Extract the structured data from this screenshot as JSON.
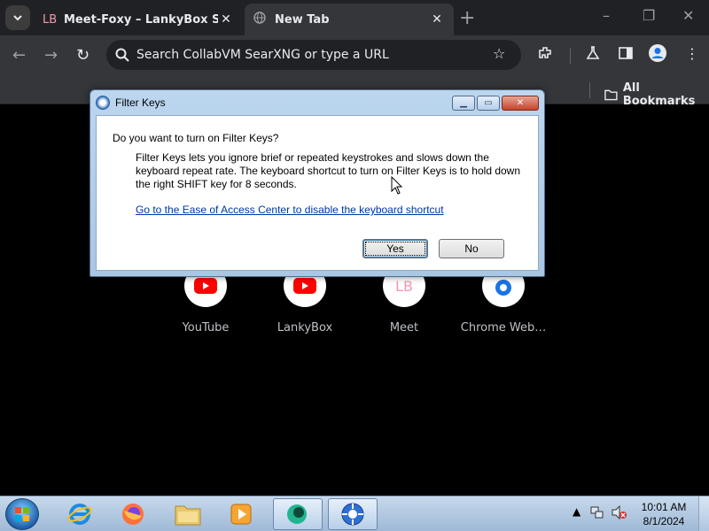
{
  "browser": {
    "tabs": [
      {
        "favicon": "LB",
        "title": "Meet-Foxy – LankyBox Shop"
      },
      {
        "favicon": "globe-icon",
        "title": "New Tab"
      }
    ],
    "new_tab_symbol": "+",
    "window_controls": {
      "minimize": "–",
      "maximize": "❐",
      "close": "✕"
    },
    "omnibox_placeholder": "Search CollabVM SearXNG or type a URL",
    "bookmarks_label": "All Bookmarks",
    "shortcuts": [
      {
        "label": "YouTube",
        "icon": "youtube-icon"
      },
      {
        "label": "LankyBox",
        "icon": "youtube-icon"
      },
      {
        "label": "Meet",
        "icon": "lb-icon",
        "icon_text": "LB"
      },
      {
        "label": "Chrome Web…",
        "icon": "chrome-web-store-icon"
      }
    ]
  },
  "dialog": {
    "title": "Filter Keys",
    "question": "Do you want to turn on Filter Keys?",
    "description": "Filter Keys lets you ignore brief or repeated keystrokes and slows down the keyboard repeat rate.  The keyboard shortcut to turn on Filter Keys is to hold down the right SHIFT key for 8 seconds.",
    "link": "Go to the Ease of Access Center to disable the keyboard shortcut",
    "yes": "Yes",
    "no": "No"
  },
  "taskbar": {
    "apps": [
      "internet-explorer-icon",
      "firefox-icon",
      "file-explorer-icon",
      "media-player-icon",
      "vm-app-icon",
      "remote-app-icon"
    ],
    "time": "10:01 AM",
    "date": "8/1/2024"
  },
  "colors": {
    "tab_strip": "#202124",
    "toolbar": "#35363a",
    "youtube_red": "#ff0000",
    "link_blue": "#0033aa"
  }
}
